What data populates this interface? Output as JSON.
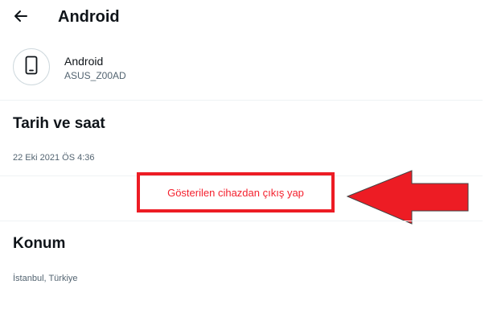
{
  "header": {
    "title": "Android",
    "back_icon": "arrow-left-icon"
  },
  "device": {
    "icon": "smartphone-icon",
    "name": "Android",
    "model": "ASUS_Z00AD"
  },
  "datetime": {
    "title": "Tarih ve saat",
    "value": "22 Eki 2021 ÖS 4:36"
  },
  "logout": {
    "label": "Gösterilen cihazdan çıkış yap"
  },
  "location": {
    "title": "Konum",
    "value": "İstanbul, Türkiye"
  },
  "colors": {
    "danger": "#f4212e",
    "annotation_red": "#ed1c24"
  }
}
